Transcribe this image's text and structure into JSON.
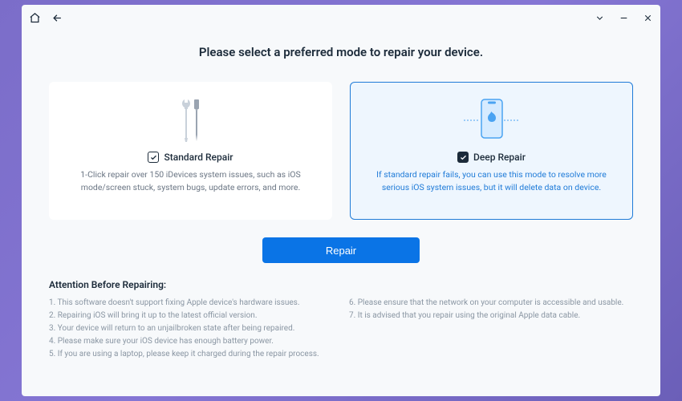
{
  "heading": "Please select a preferred mode to repair your device.",
  "cards": [
    {
      "label": "Standard Repair",
      "description": "1-Click repair over 150 iDevices system issues, such as iOS mode/screen stuck, system bugs, update errors, and more."
    },
    {
      "label": "Deep Repair",
      "description": "If standard repair fails, you can use this mode to resolve more serious iOS system issues, but it will delete data on device."
    }
  ],
  "repair_button": "Repair",
  "attention": {
    "title": "Attention Before Repairing:",
    "left": [
      "1. This software doesn't support fixing Apple device's hardware issues.",
      "2. Repairing iOS will bring it up to the latest official version.",
      "3. Your device will return to an unjailbroken state after being repaired.",
      "4. Please make sure your iOS device has enough battery power.",
      "5. If you are using a laptop, please keep it charged during the repair process."
    ],
    "right": [
      "6. Please ensure that the network on your computer is accessible and usable.",
      "7. It is advised that you repair using the original Apple data cable."
    ]
  }
}
